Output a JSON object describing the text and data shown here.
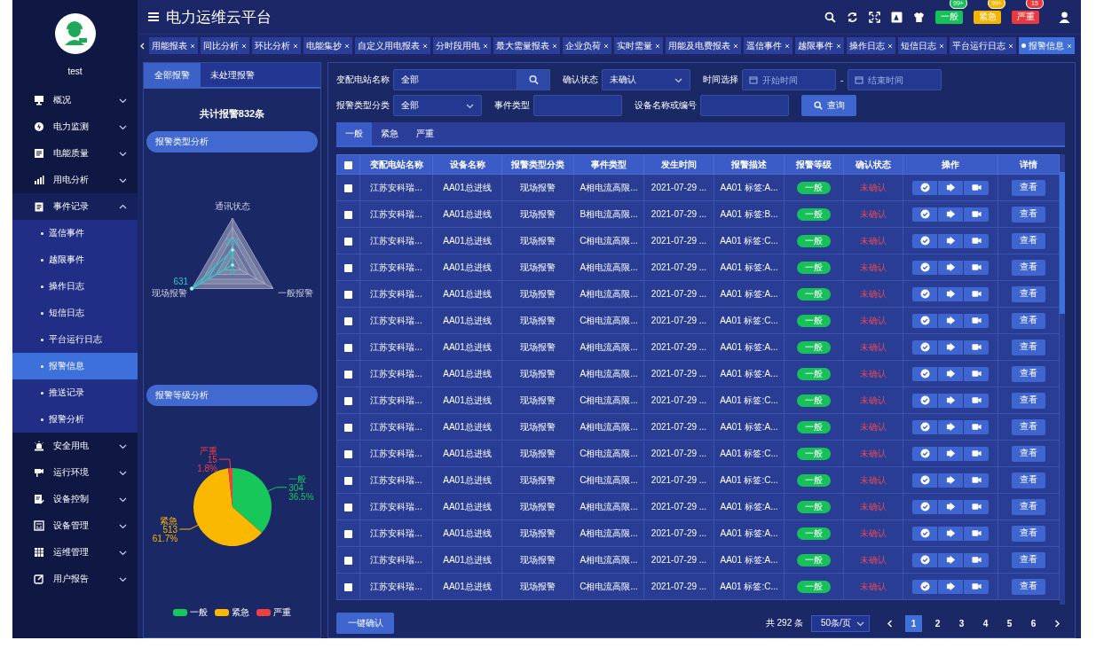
{
  "header": {
    "title": "电力运维云平台",
    "alerts": [
      {
        "label": "一般",
        "count": "99+",
        "color": "#18c05a"
      },
      {
        "label": "紧急",
        "count": "99+",
        "color": "#f5b400"
      },
      {
        "label": "严重",
        "count": "15",
        "color": "#e8393e"
      }
    ]
  },
  "tabs": [
    {
      "label": "用能报表",
      "selected": false
    },
    {
      "label": "同比分析",
      "selected": false
    },
    {
      "label": "环比分析",
      "selected": false
    },
    {
      "label": "电能集抄",
      "selected": false
    },
    {
      "label": "自定义用电报表",
      "selected": false
    },
    {
      "label": "分时段用电",
      "selected": false
    },
    {
      "label": "最大需量报表",
      "selected": false
    },
    {
      "label": "企业负荷",
      "selected": false
    },
    {
      "label": "实时需量",
      "selected": false
    },
    {
      "label": "用能及电费报表",
      "selected": false
    },
    {
      "label": "遥信事件",
      "selected": false
    },
    {
      "label": "越限事件",
      "selected": false
    },
    {
      "label": "操作日志",
      "selected": false
    },
    {
      "label": "短信日志",
      "selected": false
    },
    {
      "label": "平台运行日志",
      "selected": false
    },
    {
      "label": "报警信息",
      "selected": true
    }
  ],
  "user": {
    "name": "test"
  },
  "sidebar": {
    "items": [
      {
        "label": "概况",
        "expanded": false
      },
      {
        "label": "电力监测",
        "expanded": false
      },
      {
        "label": "电能质量",
        "expanded": false
      },
      {
        "label": "用电分析",
        "expanded": false
      },
      {
        "label": "事件记录",
        "expanded": true,
        "children": [
          {
            "label": "遥信事件",
            "selected": false
          },
          {
            "label": "越限事件",
            "selected": false
          },
          {
            "label": "操作日志",
            "selected": false
          },
          {
            "label": "短信日志",
            "selected": false
          },
          {
            "label": "平台运行日志",
            "selected": false
          },
          {
            "label": "报警信息",
            "selected": true
          },
          {
            "label": "推送记录",
            "selected": false
          },
          {
            "label": "报警分析",
            "selected": false
          }
        ]
      },
      {
        "label": "安全用电",
        "expanded": false
      },
      {
        "label": "运行环境",
        "expanded": false
      },
      {
        "label": "设备控制",
        "expanded": false
      },
      {
        "label": "设备管理",
        "expanded": false
      },
      {
        "label": "运维管理",
        "expanded": false
      },
      {
        "label": "用户报告",
        "expanded": false
      }
    ]
  },
  "left_panel": {
    "tabs": [
      {
        "label": "全部报警",
        "selected": true
      },
      {
        "label": "未处理报警",
        "selected": false
      }
    ],
    "total": "共计报警832条",
    "type_section": {
      "title": "报警类型分析",
      "radar": {
        "axes": [
          {
            "label": "通讯状态",
            "reading": "201"
          },
          {
            "label": "现场报警",
            "reading": "631"
          },
          {
            "label": "一般报警",
            "reading": "0"
          }
        ]
      }
    },
    "level_section": {
      "title": "报警等级分析",
      "chart_data": {
        "type": "pie",
        "categories": [
          "一般",
          "紧急",
          "严重"
        ],
        "values": [
          36.5,
          61.7,
          1.8
        ],
        "value_labels": [
          "36.5%",
          "61.7%",
          "1.8%"
        ],
        "annotations": [
          "304",
          "513",
          "15"
        ],
        "colors": [
          "#18c75a",
          "#fbb800",
          "#ee3f45"
        ],
        "data_labels": true,
        "legend": "bottom"
      }
    }
  },
  "filter_rows": [
    [
      {
        "kind": "search",
        "label": "变配电站名称",
        "value": "全部"
      },
      {
        "kind": "select",
        "label": "确认状态",
        "value": "未确认"
      },
      {
        "kind": "daterange",
        "label": "时间选择",
        "start_placeholder": "开始时间",
        "separator": "-",
        "end_placeholder": "结束时间"
      }
    ],
    [
      {
        "kind": "select",
        "label": "报警类型分类",
        "value": "全部"
      },
      {
        "kind": "text",
        "label": "事件类型"
      },
      {
        "kind": "text",
        "label": "设备名称或编号"
      },
      {
        "kind": "button",
        "label": "查询"
      }
    ]
  ],
  "alarm_tabs": [
    {
      "label": "一般",
      "selected": true
    },
    {
      "label": "紧急",
      "selected": false
    },
    {
      "label": "严重",
      "selected": false
    }
  ],
  "table": {
    "header_checked": false,
    "columns": [
      "变配电站名称",
      "设备名称",
      "报警类型分类",
      "事件类型",
      "发生时间",
      "报警描述",
      "报警等级",
      "确认状态",
      "操作",
      "详情"
    ],
    "rows": [
      {
        "checked": false,
        "station": "江苏安科瑞...",
        "device": "AA01总进线",
        "alarm_type": "现场报警",
        "event_type": "A相电流高限...",
        "time": "2021-07-29 ...",
        "description": "AA01 标签:A...",
        "grade": "一般",
        "status": "未确认",
        "detail": "查看"
      },
      {
        "checked": false,
        "station": "江苏安科瑞...",
        "device": "AA01总进线",
        "alarm_type": "现场报警",
        "event_type": "B相电流高限...",
        "time": "2021-07-29 ...",
        "description": "AA01 标签:B...",
        "grade": "一般",
        "status": "未确认",
        "detail": "查看"
      },
      {
        "checked": false,
        "station": "江苏安科瑞...",
        "device": "AA01总进线",
        "alarm_type": "现场报警",
        "event_type": "C相电流高限...",
        "time": "2021-07-29 ...",
        "description": "AA01 标签:C...",
        "grade": "一般",
        "status": "未确认",
        "detail": "查看"
      },
      {
        "checked": false,
        "station": "江苏安科瑞...",
        "device": "AA01总进线",
        "alarm_type": "现场报警",
        "event_type": "A相电流高限...",
        "time": "2021-07-29 ...",
        "description": "AA01 标签:A...",
        "grade": "一般",
        "status": "未确认",
        "detail": "查看"
      },
      {
        "checked": false,
        "station": "江苏安科瑞...",
        "device": "AA01总进线",
        "alarm_type": "现场报警",
        "event_type": "A相电流高限...",
        "time": "2021-07-29 ...",
        "description": "AA01 标签:A...",
        "grade": "一般",
        "status": "未确认",
        "detail": "查看"
      },
      {
        "checked": false,
        "station": "江苏安科瑞...",
        "device": "AA01总进线",
        "alarm_type": "现场报警",
        "event_type": "C相电流高限...",
        "time": "2021-07-29 ...",
        "description": "AA01 标签:C...",
        "grade": "一般",
        "status": "未确认",
        "detail": "查看"
      },
      {
        "checked": false,
        "station": "江苏安科瑞...",
        "device": "AA01总进线",
        "alarm_type": "现场报警",
        "event_type": "A相电流高限...",
        "time": "2021-07-29 ...",
        "description": "AA01 标签:A...",
        "grade": "一般",
        "status": "未确认",
        "detail": "查看"
      },
      {
        "checked": false,
        "station": "江苏安科瑞...",
        "device": "AA01总进线",
        "alarm_type": "现场报警",
        "event_type": "A相电流高限...",
        "time": "2021-07-29 ...",
        "description": "AA01 标签:A...",
        "grade": "一般",
        "status": "未确认",
        "detail": "查看"
      },
      {
        "checked": false,
        "station": "江苏安科瑞...",
        "device": "AA01总进线",
        "alarm_type": "现场报警",
        "event_type": "C相电流高限...",
        "time": "2021-07-29 ...",
        "description": "AA01 标签:C...",
        "grade": "一般",
        "status": "未确认",
        "detail": "查看"
      },
      {
        "checked": false,
        "station": "江苏安科瑞...",
        "device": "AA01总进线",
        "alarm_type": "现场报警",
        "event_type": "A相电流高限...",
        "time": "2021-07-29 ...",
        "description": "AA01 标签:A...",
        "grade": "一般",
        "status": "未确认",
        "detail": "查看"
      },
      {
        "checked": false,
        "station": "江苏安科瑞...",
        "device": "AA01总进线",
        "alarm_type": "现场报警",
        "event_type": "C相电流高限...",
        "time": "2021-07-29 ...",
        "description": "AA01 标签:C...",
        "grade": "一般",
        "status": "未确认",
        "detail": "查看"
      },
      {
        "checked": false,
        "station": "江苏安科瑞...",
        "device": "AA01总进线",
        "alarm_type": "现场报警",
        "event_type": "C相电流高限...",
        "time": "2021-07-29 ...",
        "description": "AA01 标签:C...",
        "grade": "一般",
        "status": "未确认",
        "detail": "查看"
      },
      {
        "checked": false,
        "station": "江苏安科瑞...",
        "device": "AA01总进线",
        "alarm_type": "现场报警",
        "event_type": "A相电流高限...",
        "time": "2021-07-29 ...",
        "description": "AA01 标签:A...",
        "grade": "一般",
        "status": "未确认",
        "detail": "查看"
      },
      {
        "checked": false,
        "station": "江苏安科瑞...",
        "device": "AA01总进线",
        "alarm_type": "现场报警",
        "event_type": "A相电流高限...",
        "time": "2021-07-29 ...",
        "description": "AA01 标签:A...",
        "grade": "一般",
        "status": "未确认",
        "detail": "查看"
      },
      {
        "checked": false,
        "station": "江苏安科瑞...",
        "device": "AA01总进线",
        "alarm_type": "现场报警",
        "event_type": "A相电流高限...",
        "time": "2021-07-29 ...",
        "description": "AA01 标签:A...",
        "grade": "一般",
        "status": "未确认",
        "detail": "查看"
      },
      {
        "checked": false,
        "station": "江苏安科瑞...",
        "device": "AA01总进线",
        "alarm_type": "现场报警",
        "event_type": "C相电流高限...",
        "time": "2021-07-29 ...",
        "description": "AA01 标签:C...",
        "grade": "一般",
        "status": "未确认",
        "detail": "查看"
      }
    ]
  },
  "footer": {
    "confirm_all": "一键确认",
    "total": "共 292 条",
    "page_size": "50条/页",
    "pages": [
      {
        "label": "1",
        "selected": true
      },
      {
        "label": "2",
        "selected": false
      },
      {
        "label": "3",
        "selected": false
      },
      {
        "label": "4",
        "selected": false
      },
      {
        "label": "5",
        "selected": false
      },
      {
        "label": "6",
        "selected": false
      }
    ]
  }
}
